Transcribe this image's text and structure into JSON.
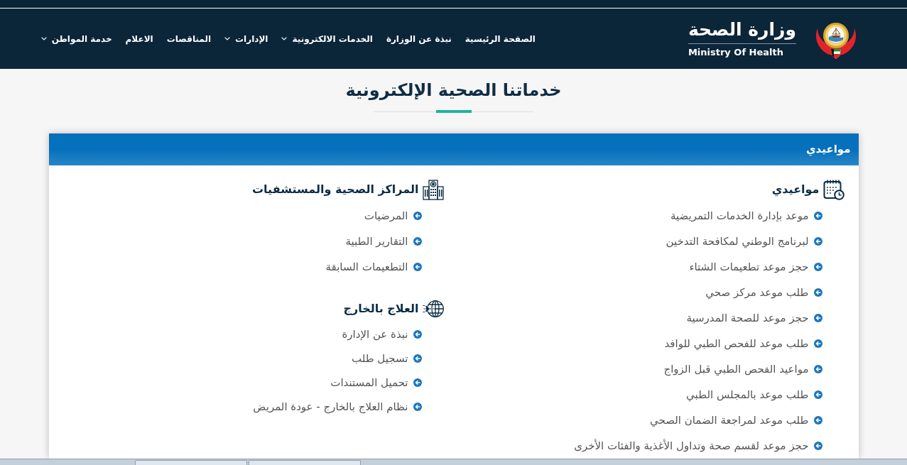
{
  "header": {
    "logo": {
      "arabic_name": "وزارة الصحة",
      "english_name": "Ministry Of Health"
    },
    "nav": [
      {
        "label": "الصفحة الرئيسية",
        "has_menu": false
      },
      {
        "label": "نبذة عن الوزارة",
        "has_menu": false
      },
      {
        "label": "الخدمات الالكترونية",
        "has_menu": true
      },
      {
        "label": "الإدارات",
        "has_menu": true
      },
      {
        "label": "المناقصات",
        "has_menu": false
      },
      {
        "label": "الاعلام",
        "has_menu": false
      },
      {
        "label": "خدمة المواطن",
        "has_menu": true
      }
    ]
  },
  "page_title": "خدماتنا الصحية الإلكترونية",
  "panel": {
    "title": "مواعيدي",
    "columns": [
      {
        "sections": [
          {
            "kind": "appointments",
            "heading": "مواعيدي",
            "links": [
              "موعد بإدارة الخدمات التمريضية",
              "لبرنامج الوطني لمكافحة التدخين",
              "حجز موعد تطعيمات الشتاء",
              "طلب موعد مركز صحي",
              "حجز موعد للصحة المدرسية",
              "طلب موعد للفحص الطبي للوافد",
              "مواعيد الفحص الطبي قبل الزواج",
              "طلب موعد بالمجلس الطبي",
              "طلب موعد لمراجعة الضمان الصحي",
              "حجز موعد لقسم صحة وتداول الأغذية والفئات الأخرى"
            ]
          }
        ]
      },
      {
        "sections": [
          {
            "kind": "facilities",
            "heading": "المراكز الصحية والمستشفيات",
            "links": [
              "المرضيات",
              "التقارير الطبية",
              "التطعيمات السابقة"
            ]
          },
          {
            "kind": "travel",
            "heading": "العلاج بالخارج",
            "links": [
              "نبذة عن الإدارة",
              "تسجيل طلب",
              "تحميل المستندات",
              "نظام العلاج بالخارج - عودة المريض"
            ]
          }
        ]
      }
    ]
  }
}
